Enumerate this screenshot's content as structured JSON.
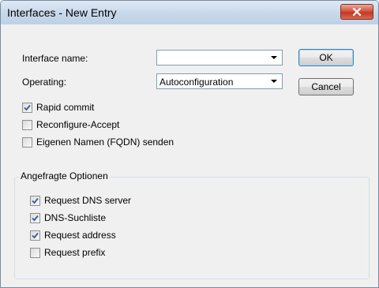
{
  "window": {
    "title": "Interfaces - New Entry"
  },
  "fields": {
    "interface_name": {
      "label": "Interface name:",
      "value": ""
    },
    "operating": {
      "label": "Operating:",
      "value": "Autoconfiguration"
    }
  },
  "buttons": {
    "ok": "OK",
    "cancel": "Cancel"
  },
  "options": [
    {
      "label": "Rapid commit",
      "checked": true
    },
    {
      "label": "Reconfigure-Accept",
      "checked": false
    },
    {
      "label": "Eigenen Namen (FQDN) senden",
      "checked": false
    }
  ],
  "requested": {
    "title": "Angefragte Optionen",
    "items": [
      {
        "label": "Request DNS server",
        "checked": true
      },
      {
        "label": "DNS-Suchliste",
        "checked": true
      },
      {
        "label": "Request address",
        "checked": true
      },
      {
        "label": "Request prefix",
        "checked": false
      }
    ]
  }
}
